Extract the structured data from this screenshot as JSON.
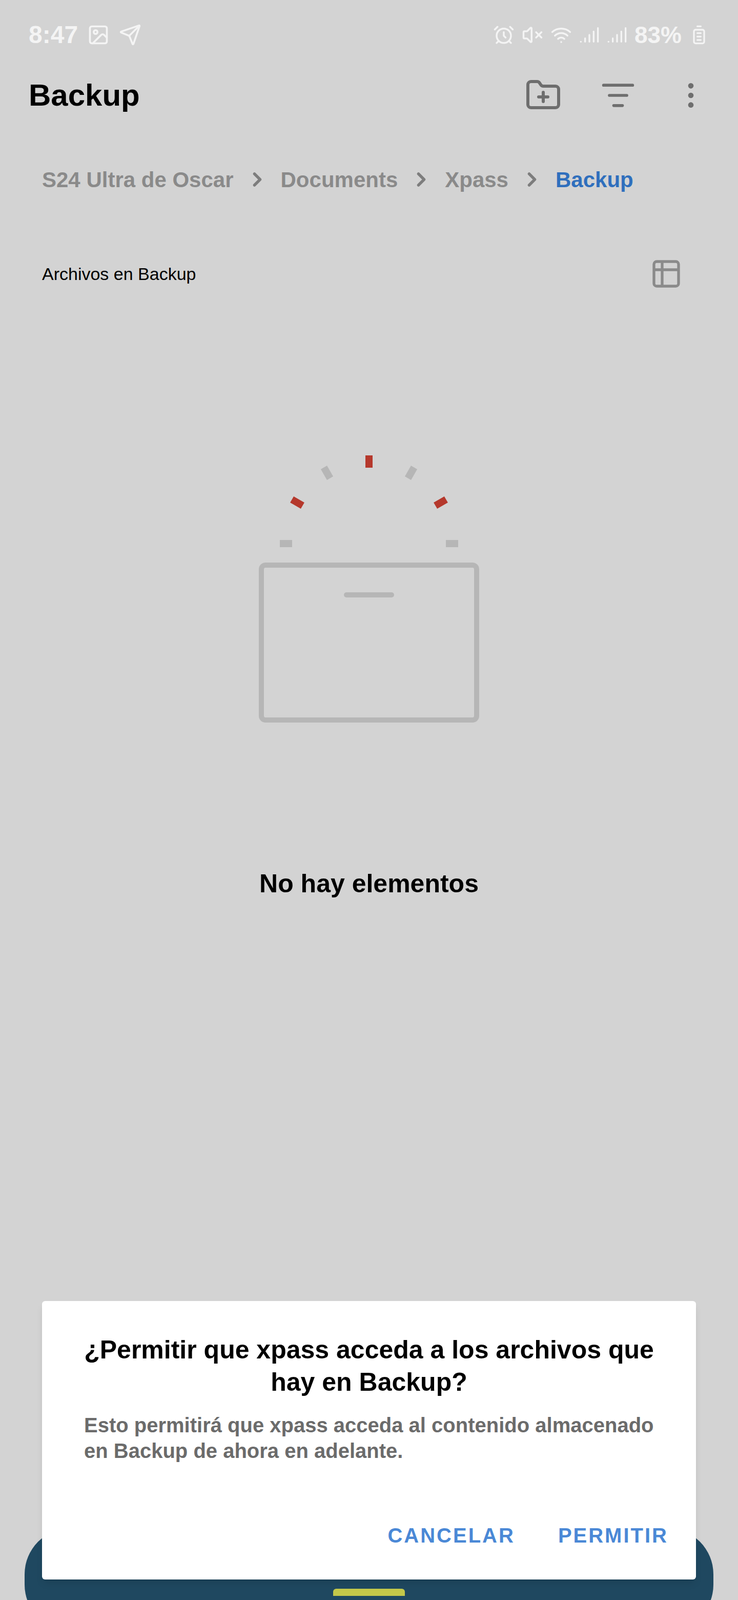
{
  "status_bar": {
    "time": "8:47",
    "battery": "83%"
  },
  "app_bar": {
    "title": "Backup"
  },
  "breadcrumbs": [
    {
      "label": "S24 Ultra de Oscar",
      "selected": false
    },
    {
      "label": "Documents",
      "selected": false
    },
    {
      "label": "Xpass",
      "selected": false
    },
    {
      "label": "Backup",
      "selected": true
    }
  ],
  "section": {
    "title": "Archivos en Backup"
  },
  "empty_state": {
    "message": "No hay elementos"
  },
  "dialog": {
    "title": "¿Permitir que xpass acceda a los archivos que hay en Backup?",
    "message": "Esto permitirá que xpass acceda al contenido almacenado en Backup de ahora en adelante.",
    "buttons": [
      "CANCELAR",
      "PERMITIR"
    ]
  }
}
